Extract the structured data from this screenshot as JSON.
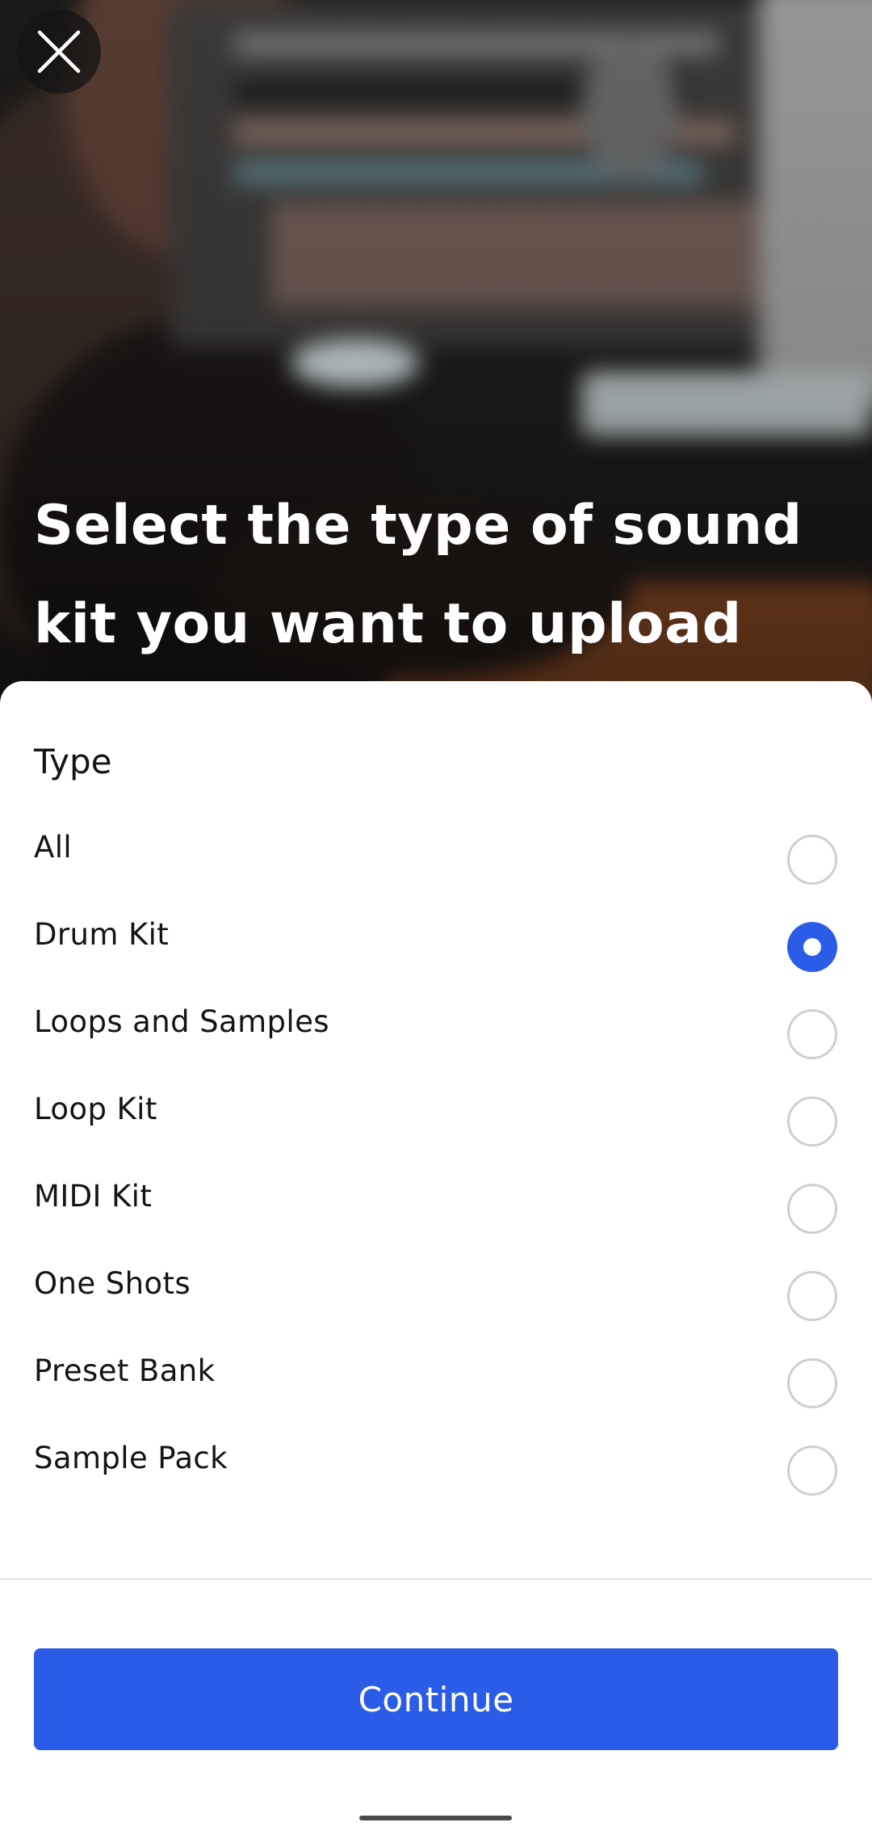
{
  "hero": {
    "title": "Select the type of sound kit you want to upload"
  },
  "close_icon": "close-icon",
  "type_section": {
    "heading": "Type",
    "options": [
      {
        "label": "All",
        "selected": false
      },
      {
        "label": "Drum Kit",
        "selected": true
      },
      {
        "label": "Loops and Samples",
        "selected": false
      },
      {
        "label": "Loop Kit",
        "selected": false
      },
      {
        "label": "MIDI Kit",
        "selected": false
      },
      {
        "label": "One Shots",
        "selected": false
      },
      {
        "label": "Preset Bank",
        "selected": false
      },
      {
        "label": "Sample Pack",
        "selected": false
      }
    ]
  },
  "footer": {
    "continue_label": "Continue"
  },
  "colors": {
    "accent": "#2a5ce8",
    "radio_border": "#cfcfcf",
    "text": "#141414",
    "sheet_background": "#ffffff"
  }
}
